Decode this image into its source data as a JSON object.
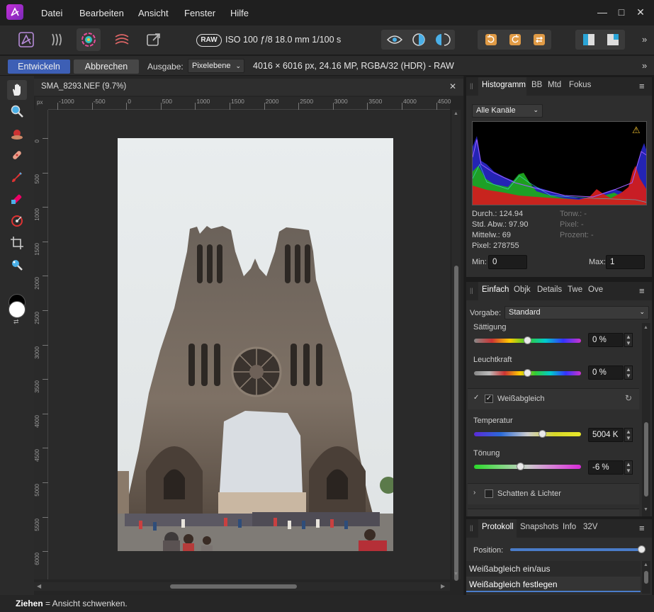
{
  "menu": {
    "items": [
      "Datei",
      "Bearbeiten",
      "Ansicht",
      "Fenster",
      "Hilfe"
    ]
  },
  "window_controls": {
    "minimize": "—",
    "maximize": "□",
    "close": "✕"
  },
  "toolbar": {
    "raw_badge": "RAW",
    "exif": "ISO 100 ƒ/8 18.0 mm 1/100 s",
    "overflow": "»"
  },
  "context": {
    "develop_label": "Entwickeln",
    "cancel_label": "Abbrechen",
    "output_label": "Ausgabe:",
    "output_value": "Pixelebene",
    "image_info": "4016 × 6016 px, 24.16 MP, RGBA/32 (HDR) - RAW",
    "overflow": "»"
  },
  "document": {
    "tab_title": "SMA_8293.NEF (9.7%)",
    "close": "✕",
    "ruler_unit": "px",
    "ruler_x": [
      "-1000",
      "-500",
      "0",
      "500",
      "1000",
      "1500",
      "2000",
      "2500",
      "3000",
      "3500",
      "4000",
      "4500"
    ],
    "ruler_y": [
      "0",
      "500",
      "1000",
      "1500",
      "2000",
      "2500",
      "3000",
      "3500",
      "4000",
      "4500",
      "5000",
      "5500",
      "6000"
    ]
  },
  "histogram_panel": {
    "tabs": [
      "Histogramm",
      "BB",
      "Mtd",
      "Fokus"
    ],
    "channel": "Alle Kanäle",
    "warning_icon": "⚠",
    "stats_left": [
      "Durch.: 124.94",
      "Std. Abw.: 97.90",
      "Mittelw.: 69",
      "Pixel: 278755"
    ],
    "stats_right": [
      "Tonw.: -",
      "Pixel: -",
      "Prozent: -"
    ],
    "min_label": "Min:",
    "min_value": "0",
    "max_label": "Max:",
    "max_value": "1"
  },
  "adjust_panel": {
    "tabs": [
      "Einfach",
      "Objk",
      "Details",
      "Twe",
      "Ove"
    ],
    "preset_label": "Vorgabe:",
    "preset_value": "Standard",
    "saturation_label": "Sättigung",
    "saturation_value": "0 %",
    "vibrance_label": "Leuchtkraft",
    "vibrance_value": "0 %",
    "wb_section": "Weißabgleich",
    "temperature_label": "Temperatur",
    "temperature_value": "5004 K",
    "tint_label": "Tönung",
    "tint_value": "-6 %",
    "shadows_section": "Schatten & Lichter",
    "levels": {
      "saturation": 0.5,
      "vibrance": 0.5,
      "temperature": 0.64,
      "tint": 0.44
    }
  },
  "history_panel": {
    "tabs": [
      "Protokoll",
      "Snapshots",
      "Info",
      "32V"
    ],
    "position_label": "Position:",
    "position_level": 1.0,
    "entries": [
      "Weißabgleich ein/aus",
      "Weißabgleich festlegen"
    ]
  },
  "status": {
    "bold": "Ziehen",
    "text": " = Ansicht schwenken."
  },
  "colors": {
    "accent": "#4a7cc9",
    "develop_button": "#3d5fb5",
    "panel": "#2e2e2e",
    "histogram_bg": "#000000"
  }
}
